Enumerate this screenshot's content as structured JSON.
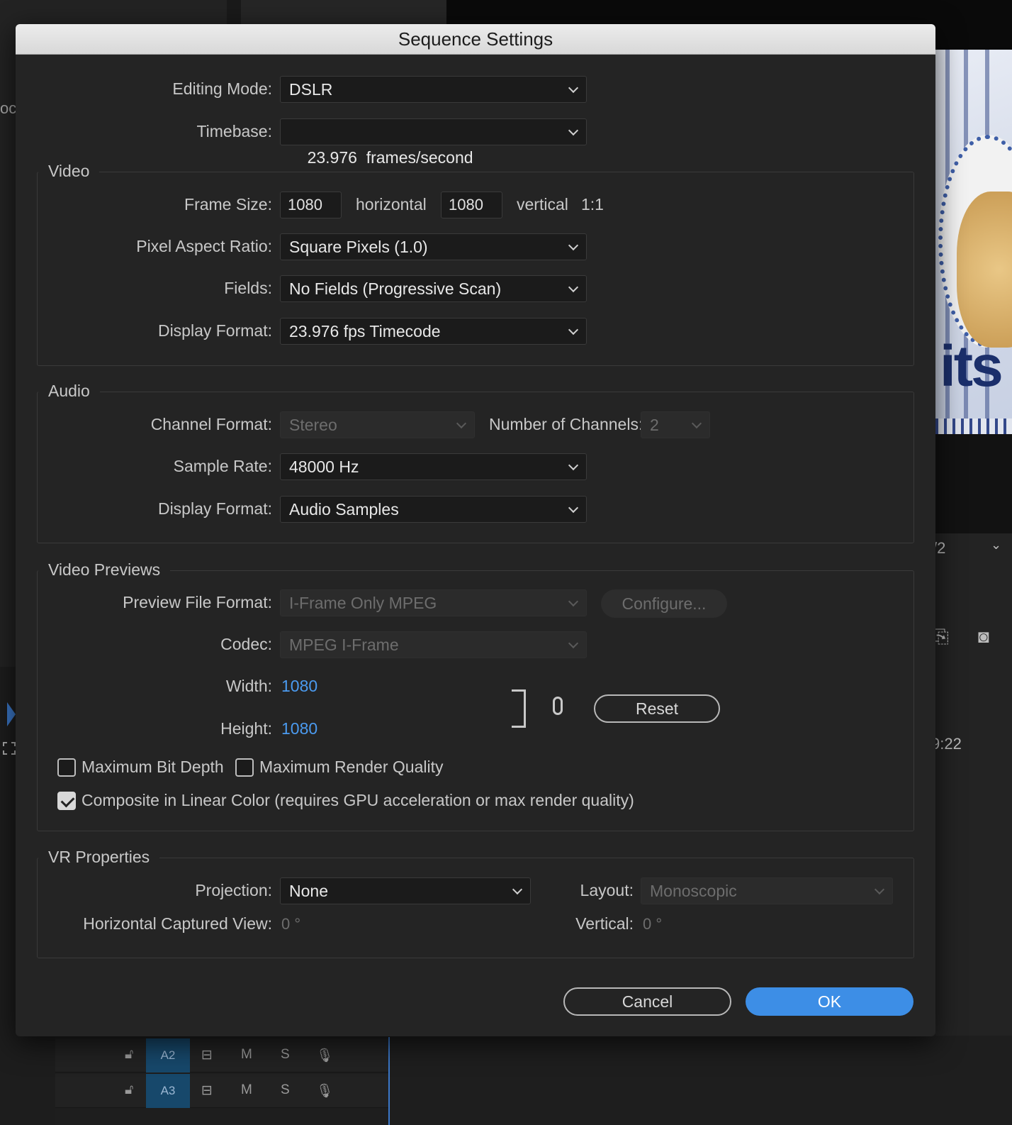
{
  "dialog": {
    "title": "Sequence Settings"
  },
  "general": {
    "editing_mode_label": "Editing Mode:",
    "editing_mode_value": "DSLR",
    "timebase_label": "Timebase:",
    "timebase_value": "23.976  frames/second"
  },
  "video": {
    "title": "Video",
    "frame_size_label": "Frame Size:",
    "frame_width": "1080",
    "horizontal_label": "horizontal",
    "frame_height": "1080",
    "vertical_label": "vertical",
    "ratio": "1:1",
    "pixel_aspect_label": "Pixel Aspect Ratio:",
    "pixel_aspect_value": "Square Pixels (1.0)",
    "fields_label": "Fields:",
    "fields_value": "No Fields (Progressive Scan)",
    "display_format_label": "Display Format:",
    "display_format_value": "23.976 fps Timecode"
  },
  "audio": {
    "title": "Audio",
    "channel_format_label": "Channel Format:",
    "channel_format_value": "Stereo",
    "num_channels_label": "Number of Channels:",
    "num_channels_value": "2",
    "sample_rate_label": "Sample Rate:",
    "sample_rate_value": "48000 Hz",
    "display_format_label": "Display Format:",
    "display_format_value": "Audio Samples"
  },
  "previews": {
    "title": "Video Previews",
    "file_format_label": "Preview File Format:",
    "file_format_value": "I-Frame Only MPEG",
    "configure_label": "Configure...",
    "codec_label": "Codec:",
    "codec_value": "MPEG I-Frame",
    "width_label": "Width:",
    "width_value": "1080",
    "height_label": "Height:",
    "height_value": "1080",
    "reset_label": "Reset",
    "max_bit_depth_label": "Maximum Bit Depth",
    "max_bit_depth_checked": false,
    "max_render_label": "Maximum Render Quality",
    "max_render_checked": false,
    "linear_color_label": "Composite in Linear Color (requires GPU acceleration or max render quality)",
    "linear_color_checked": true
  },
  "vr": {
    "title": "VR Properties",
    "projection_label": "Projection:",
    "projection_value": "None",
    "layout_label": "Layout:",
    "layout_value": "Monoscopic",
    "h_view_label": "Horizontal Captured View:",
    "h_view_value": "0 °",
    "vertical_label": "Vertical:",
    "vertical_value": "0 °"
  },
  "buttons": {
    "cancel": "Cancel",
    "ok": "OK"
  },
  "background": {
    "left_edge_text": "oci",
    "right_fraction": "/2",
    "right_time": "9:22",
    "preview_text": "its",
    "tracks": [
      {
        "name": "A2",
        "m": "M",
        "s": "S"
      },
      {
        "name": "A3",
        "m": "M",
        "s": "S"
      }
    ]
  },
  "colors": {
    "accent": "#3d8ee6",
    "link_value": "#4b9bf0",
    "track_bg": "#17486b"
  }
}
